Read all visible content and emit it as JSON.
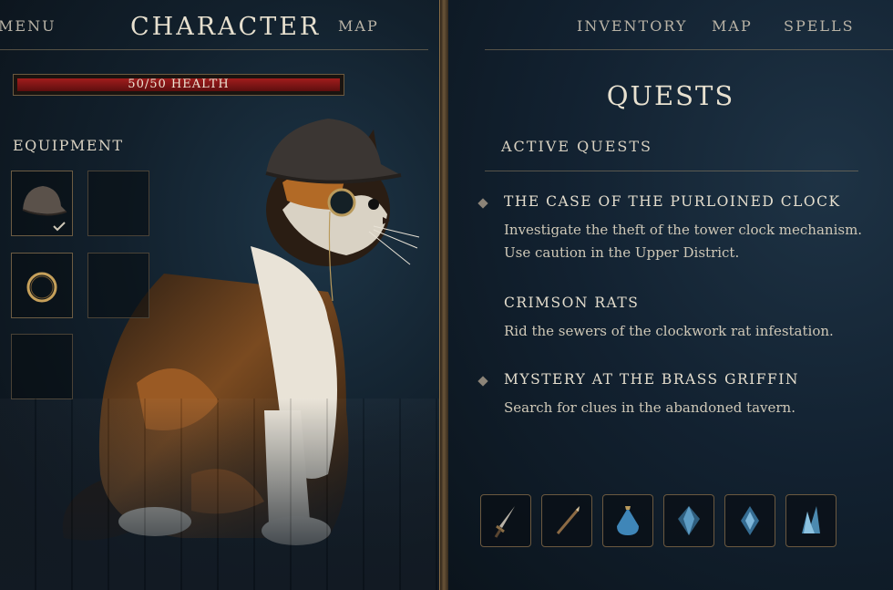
{
  "nav_left": {
    "menu": "MENU",
    "title": "CHARACTER",
    "map": "MAP"
  },
  "nav_right": {
    "inventory": "INVENTORY",
    "map": "MAP",
    "spells": "SPELLS"
  },
  "health": {
    "label": "50/50 HEALTH",
    "current": 50,
    "max": 50
  },
  "equipment": {
    "heading": "EQUIPMENT",
    "slots": [
      {
        "item": "hat-icon",
        "equipped": true
      },
      {
        "item": ""
      },
      {
        "item": "ring-icon"
      },
      {
        "item": ""
      },
      {
        "item": ""
      }
    ]
  },
  "quests": {
    "title": "QUESTS",
    "active_heading": "ACTIVE QUESTS",
    "list": [
      {
        "name": "THE CASE OF THE PURLOINED CLOCK",
        "desc": "Investigate the theft of the tower clock mechanism. Use caution in the Upper District."
      },
      {
        "name": "CRIMSON RATS",
        "desc": "Rid the sewers of the clockwork rat infestation."
      },
      {
        "name": "MYSTERY AT THE BRASS GRIFFIN",
        "desc": "Search for clues in the abandoned tavern."
      }
    ]
  },
  "hotbar": [
    "dagger-icon",
    "wand-icon",
    "potion-icon",
    "crystal-icon",
    "gem-icon",
    "shard-icon"
  ],
  "colors": {
    "health": "#a11d1d",
    "accent_gold": "#8a6d45",
    "crystal": "#5d9cc4"
  }
}
